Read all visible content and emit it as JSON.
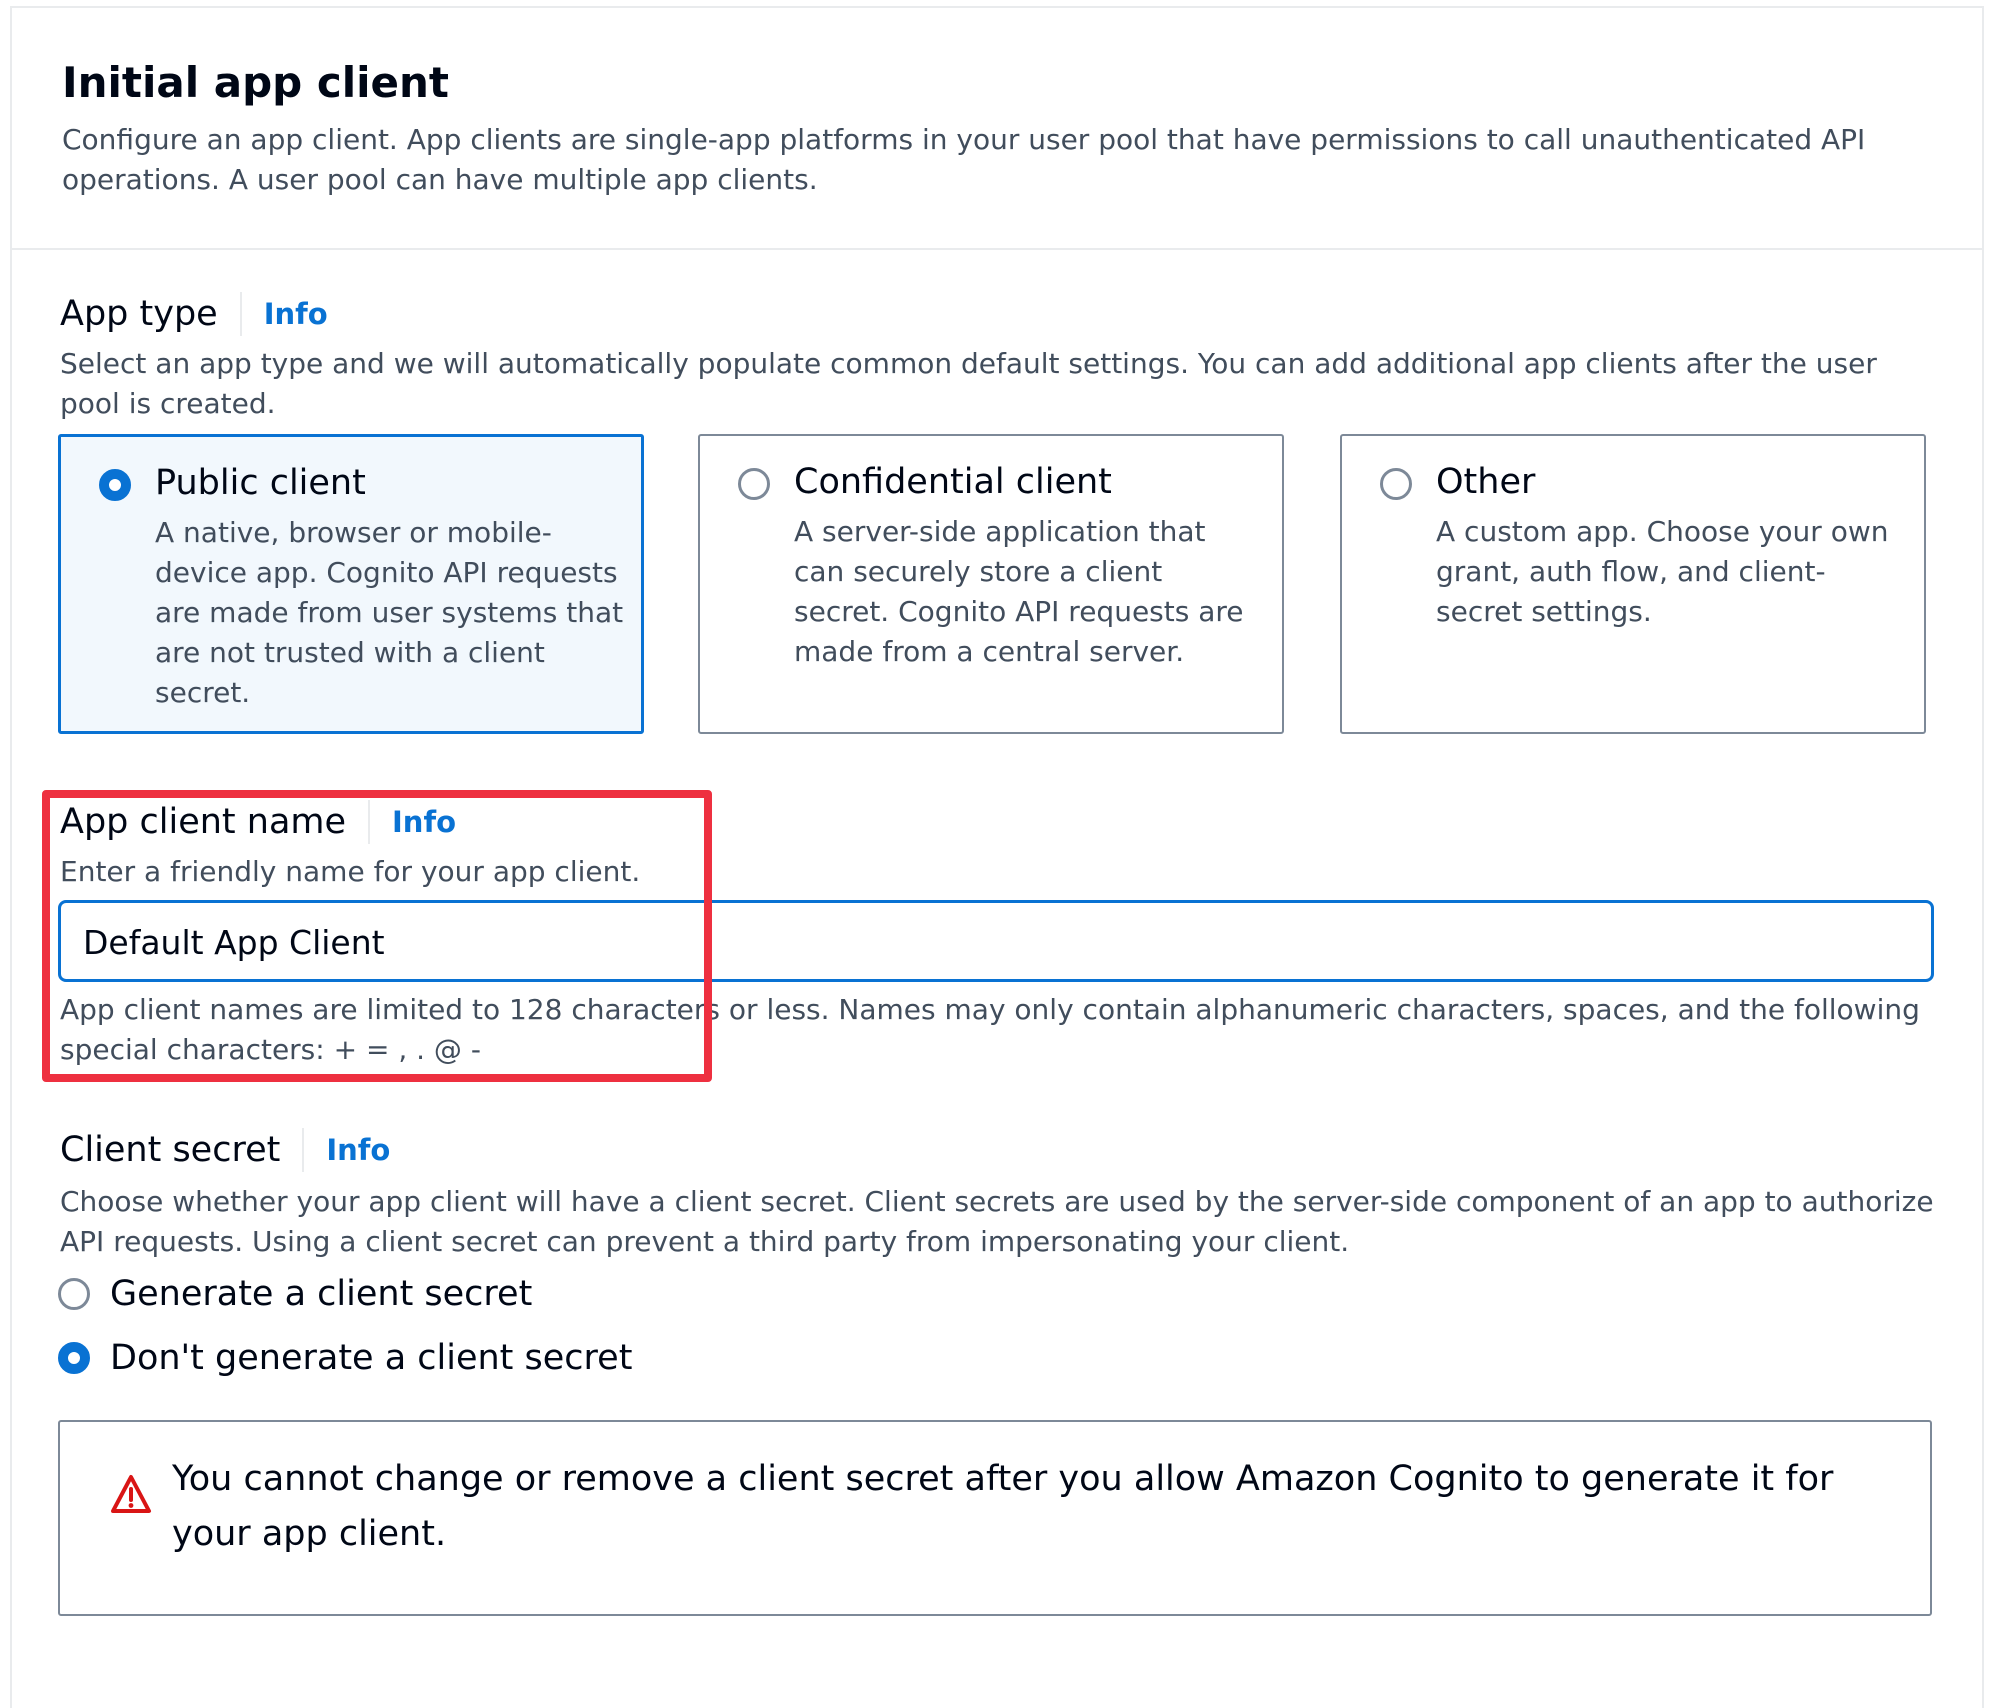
{
  "header": {
    "title": "Initial app client",
    "description": "Configure an app client. App clients are single-app platforms in your user pool that have permissions to call unauthenticated API operations. A user pool can have multiple app clients."
  },
  "app_type": {
    "label": "App type",
    "info": "Info",
    "description": "Select an app type and we will automatically populate common default settings. You can add additional app clients after the user pool is created.",
    "options": [
      {
        "title": "Public client",
        "description": "A native, browser or mobile-device app. Cognito API requests are made from user systems that are not trusted with a client secret.",
        "selected": true
      },
      {
        "title": "Confidential client",
        "description": "A server-side application that can securely store a client secret. Cognito API requests are made from a central server.",
        "selected": false
      },
      {
        "title": "Other",
        "description": "A custom app. Choose your own grant, auth flow, and client-secret settings.",
        "selected": false
      }
    ]
  },
  "app_client_name": {
    "label": "App client name",
    "info": "Info",
    "description": "Enter a friendly name for your app client.",
    "value": "Default App Client",
    "constraint": "App client names are limited to 128 characters or less. Names may only contain alphanumeric characters, spaces, and the following special characters: + = , . @ -"
  },
  "client_secret": {
    "label": "Client secret",
    "info": "Info",
    "description": "Choose whether your app client will have a client secret. Client secrets are used by the server-side component of an app to authorize API requests. Using a client secret can prevent a third party from impersonating your client.",
    "options": [
      {
        "label": "Generate a client secret",
        "selected": false
      },
      {
        "label": "Don't generate a client secret",
        "selected": true
      }
    ],
    "warning": "You cannot change or remove a client secret after you allow Amazon Cognito to generate it for your app client."
  },
  "colors": {
    "accent": "#0972d3",
    "highlight": "#ee3040",
    "warning": "#d91515"
  }
}
